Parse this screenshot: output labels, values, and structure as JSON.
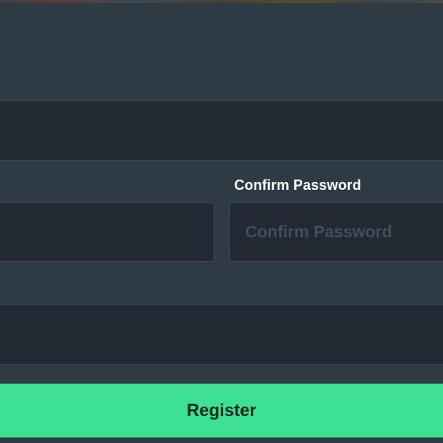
{
  "form": {
    "confirm_password": {
      "label": "Confirm Password",
      "placeholder": "Confirm Password",
      "value": ""
    },
    "register_label": "Register"
  },
  "colors": {
    "background": "#2e3a44",
    "field_background": "#222932",
    "field_border": "#3a4753",
    "accent": "#3ce193",
    "label_text": "#ffffff",
    "placeholder_text": "#3f4f5c"
  }
}
